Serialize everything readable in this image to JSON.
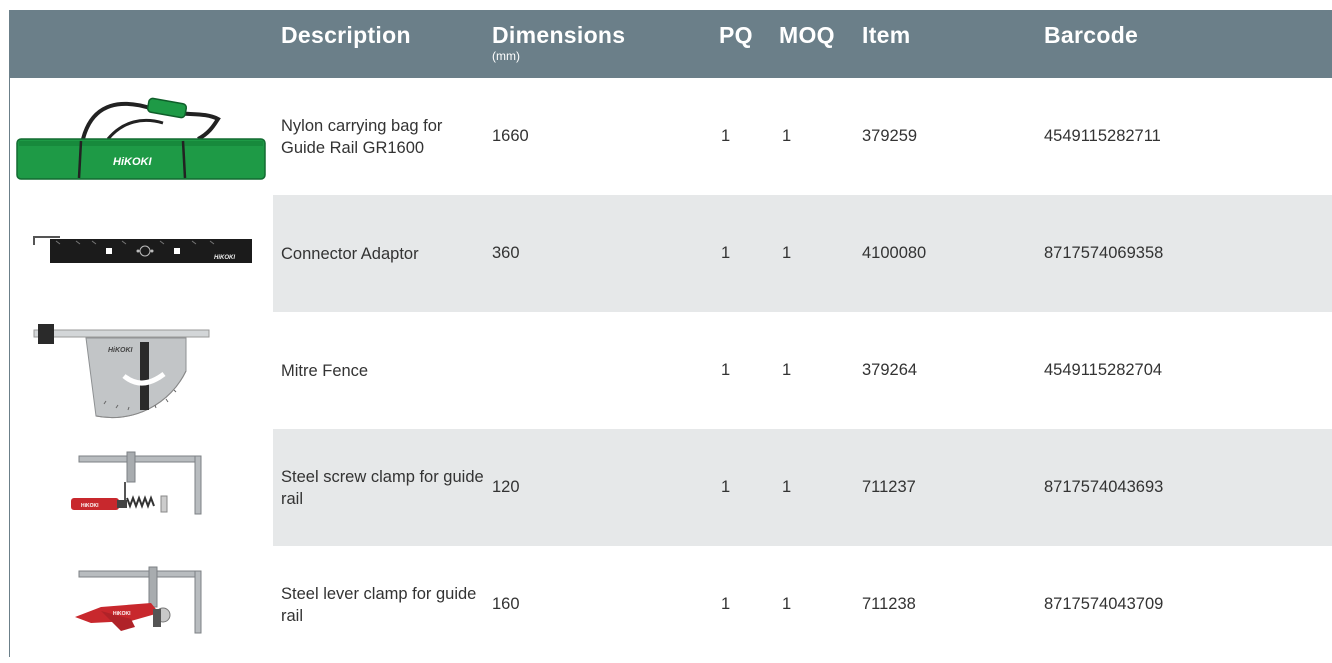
{
  "table": {
    "headers": {
      "description": "Description",
      "dimensions": "Dimensions",
      "dimensions_unit": "(mm)",
      "pq": "PQ",
      "moq": "MOQ",
      "item": "Item",
      "barcode": "Barcode"
    },
    "rows": [
      {
        "image_icon": "carrying-bag",
        "description": "Nylon carrying bag for Guide Rail GR1600",
        "dimensions": "1660",
        "pq": "1",
        "moq": "1",
        "item": "379259",
        "barcode": "4549115282711"
      },
      {
        "image_icon": "connector-adaptor",
        "description": "Connector Adaptor",
        "dimensions": "360",
        "pq": "1",
        "moq": "1",
        "item": "4100080",
        "barcode": "8717574069358"
      },
      {
        "image_icon": "mitre-fence",
        "description": "Mitre Fence",
        "dimensions": "",
        "pq": "1",
        "moq": "1",
        "item": "379264",
        "barcode": "4549115282704"
      },
      {
        "image_icon": "screw-clamp",
        "description": "Steel screw clamp for guide rail",
        "dimensions": "120",
        "pq": "1",
        "moq": "1",
        "item": "711237",
        "barcode": "8717574043693"
      },
      {
        "image_icon": "lever-clamp",
        "description": "Steel lever clamp for guide rail",
        "dimensions": "160",
        "pq": "1",
        "moq": "1",
        "item": "711238",
        "barcode": "8717574043709"
      }
    ]
  },
  "brand": {
    "logo_text": "HiKOKI"
  },
  "colors": {
    "header_bg": "#6b7f89",
    "row_shade": "#e6e8e9",
    "bag_green": "#1e9a46",
    "clamp_red": "#c8282d"
  }
}
